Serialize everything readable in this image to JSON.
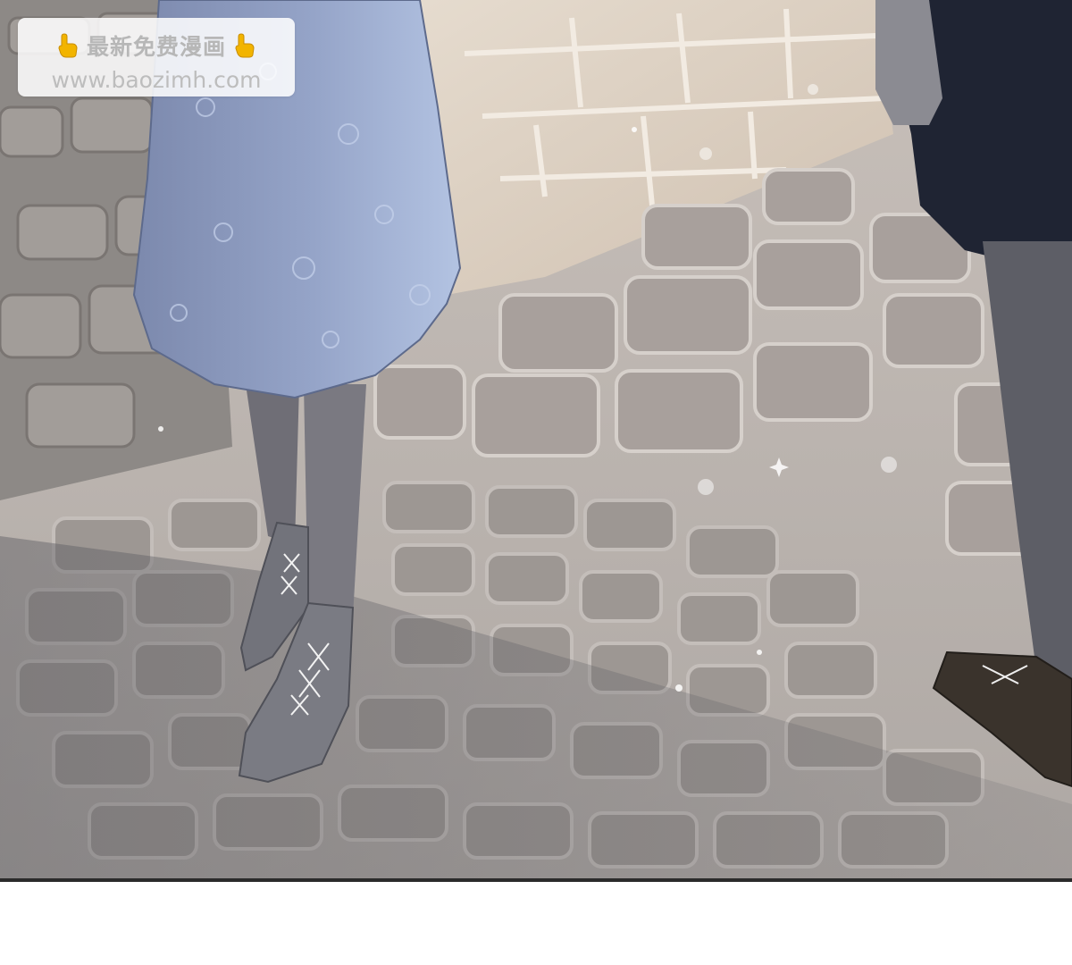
{
  "image": {
    "description_type": "manga panel",
    "palette": {
      "ground": "#b9b3ae",
      "cobble": "#a49e9a",
      "wall": "#d9ccbe",
      "skirt": "#8fa0c4",
      "boots": "#76777f",
      "dark_coat": "#1f2433",
      "brown_shoe": "#3a332c"
    }
  },
  "watermark": {
    "title": "最新免费漫画",
    "url": "www.baozimh.com",
    "icon_left": "pointing-hand-icon",
    "icon_right": "pointing-hand-icon"
  }
}
